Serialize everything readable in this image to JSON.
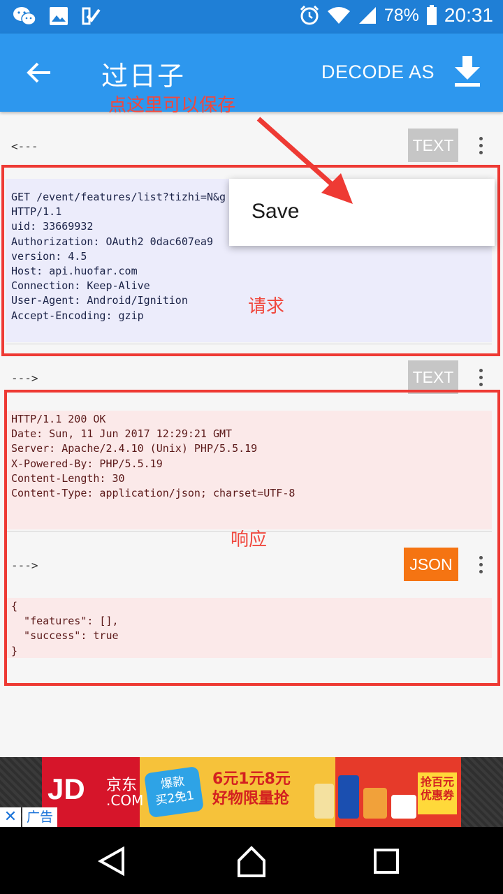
{
  "status_bar": {
    "battery": "78%",
    "time": "20:31"
  },
  "app_bar": {
    "title": "过日子",
    "decode_as": "DECODE AS"
  },
  "annotations": {
    "save_hint": "点这里可以保存",
    "request": "请求",
    "response": "响应"
  },
  "popup_menu": {
    "save": "Save"
  },
  "request": {
    "direction": "<---",
    "mode": "TEXT",
    "lines": "GET /event/features/list?tizhi=N&g\nHTTP/1.1\nuid: 33669932\nAuthorization: OAuth2 0dac607ea9\nversion: 4.5\nHost: api.huofar.com\nConnection: Keep-Alive\nUser-Agent: Android/Ignition\nAccept-Encoding: gzip"
  },
  "response": {
    "direction": "--->",
    "mode": "TEXT",
    "lines": "HTTP/1.1 200 OK\nDate: Sun, 11 Jun 2017 12:29:21 GMT\nServer: Apache/2.4.10 (Unix) PHP/5.5.19\nX-Powered-By: PHP/5.5.19\nContent-Length: 30\nContent-Type: application/json; charset=UTF-8"
  },
  "response_body": {
    "direction": "--->",
    "mode": "JSON",
    "lines": "{\n  \"features\": [],\n  \"success\": true\n}"
  },
  "ad": {
    "logo": "JD",
    "logo_cn": "京东",
    "logo_com": ".COM",
    "bubble": "爆款\n买2免1",
    "headline": "6元1元8元\n好物限量抢",
    "coupon": "抢百元\n优惠券",
    "tag": "广告",
    "close": "✕"
  },
  "colors": {
    "status_bar": "#1f7fd6",
    "app_bar": "#2d97ee",
    "annotation_red": "#ee3a34",
    "chip_gray": "#c6c6c6",
    "chip_orange": "#f57412"
  },
  "icons": [
    "wechat-icon",
    "image-icon",
    "checklist-icon",
    "alarm-icon",
    "wifi-icon",
    "signal-icon",
    "battery-icon",
    "back-arrow-icon",
    "download-icon",
    "more-vert-icon",
    "nav-back-icon",
    "nav-home-icon",
    "nav-recents-icon"
  ]
}
